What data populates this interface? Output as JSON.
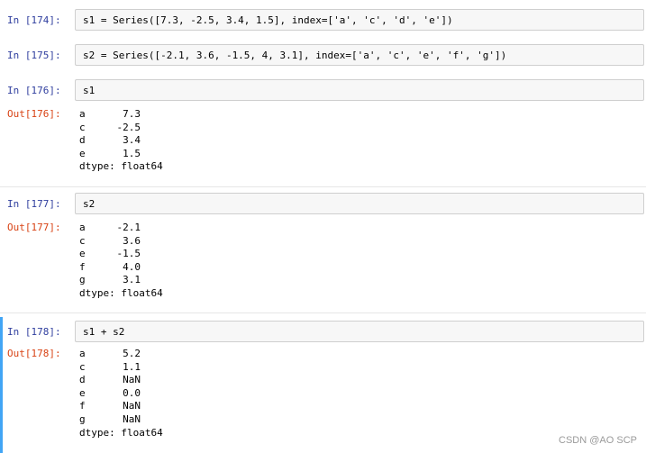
{
  "cells": [
    {
      "in_prompt": "In [174]:",
      "code": "s1 = Series([7.3, -2.5, 3.4, 1.5], index=['a', 'c', 'd', 'e'])"
    },
    {
      "in_prompt": "In [175]:",
      "code": "s2 = Series([-2.1, 3.6, -1.5, 4, 3.1], index=['a', 'c', 'e', 'f', 'g'])"
    },
    {
      "in_prompt": "In [176]:",
      "code": "s1",
      "out_prompt": "Out[176]:",
      "output": [
        {
          "index": "a",
          "value": "7.3"
        },
        {
          "index": "c",
          "value": "-2.5"
        },
        {
          "index": "d",
          "value": "3.4"
        },
        {
          "index": "e",
          "value": "1.5"
        }
      ],
      "dtype": "dtype: float64"
    },
    {
      "in_prompt": "In [177]:",
      "code": "s2",
      "out_prompt": "Out[177]:",
      "output": [
        {
          "index": "a",
          "value": "-2.1"
        },
        {
          "index": "c",
          "value": "3.6"
        },
        {
          "index": "e",
          "value": "-1.5"
        },
        {
          "index": "f",
          "value": "4.0"
        },
        {
          "index": "g",
          "value": "3.1"
        }
      ],
      "dtype": "dtype: float64"
    },
    {
      "in_prompt": "In [178]:",
      "code": "s1 + s2",
      "out_prompt": "Out[178]:",
      "output": [
        {
          "index": "a",
          "value": "5.2"
        },
        {
          "index": "c",
          "value": "1.1"
        },
        {
          "index": "d",
          "value": "NaN"
        },
        {
          "index": "e",
          "value": "0.0"
        },
        {
          "index": "f",
          "value": "NaN"
        },
        {
          "index": "g",
          "value": "NaN"
        }
      ],
      "dtype": "dtype: float64"
    }
  ],
  "watermark": "CSDN @AO SCP",
  "colors": {
    "in_prompt": "#303f9f",
    "out_prompt": "#d84315",
    "selected_bar": "#42a5f5",
    "input_bg": "#f7f7f7"
  }
}
